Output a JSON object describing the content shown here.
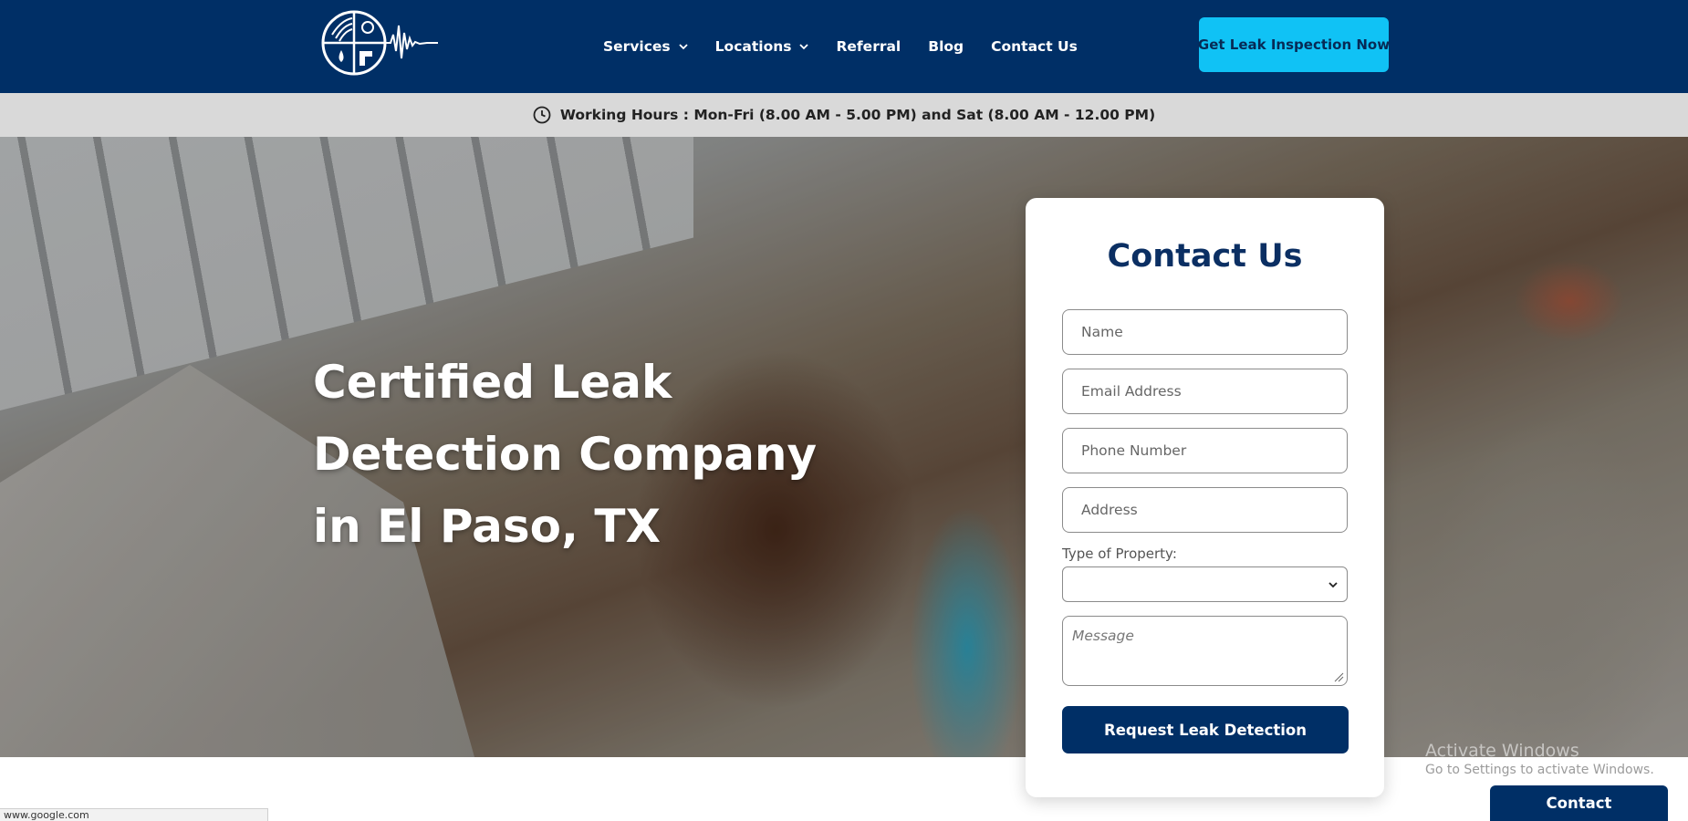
{
  "header": {
    "logo_name": "leak-detection-logo",
    "nav": [
      {
        "label": "Services",
        "has_dropdown": true
      },
      {
        "label": "Locations",
        "has_dropdown": true
      },
      {
        "label": "Referral",
        "has_dropdown": false
      },
      {
        "label": "Blog",
        "has_dropdown": false
      },
      {
        "label": "Contact Us",
        "has_dropdown": false
      }
    ],
    "cta_label": "Get Leak Inspection Now"
  },
  "hours": {
    "text": "Working Hours : Mon-Fri (8.00 AM - 5.00 PM)  and Sat (8.00 AM - 12.00 PM)",
    "icon": "clock-icon"
  },
  "hero": {
    "title_line1": "Certified Leak",
    "title_line2": "Detection Company",
    "title_line3": "in El Paso, TX"
  },
  "form": {
    "title": "Contact Us",
    "name_placeholder": "Name",
    "email_placeholder": "Email Address",
    "phone_placeholder": "Phone Number",
    "address_placeholder": "Address",
    "property_label": "Type of Property:",
    "property_value": "",
    "message_placeholder": "Message",
    "submit_label": "Request Leak Detection"
  },
  "watermark": {
    "title": "Activate Windows",
    "subtitle": "Go to Settings to activate Windows."
  },
  "status_url": "www.google.com",
  "floating_contact_label": "Contact",
  "colors": {
    "header_bg": "#002f66",
    "cta_bg": "#10c2f5",
    "hours_bg": "#d9d9d9",
    "form_title": "#0b2f63",
    "submit_bg": "#002f66"
  }
}
